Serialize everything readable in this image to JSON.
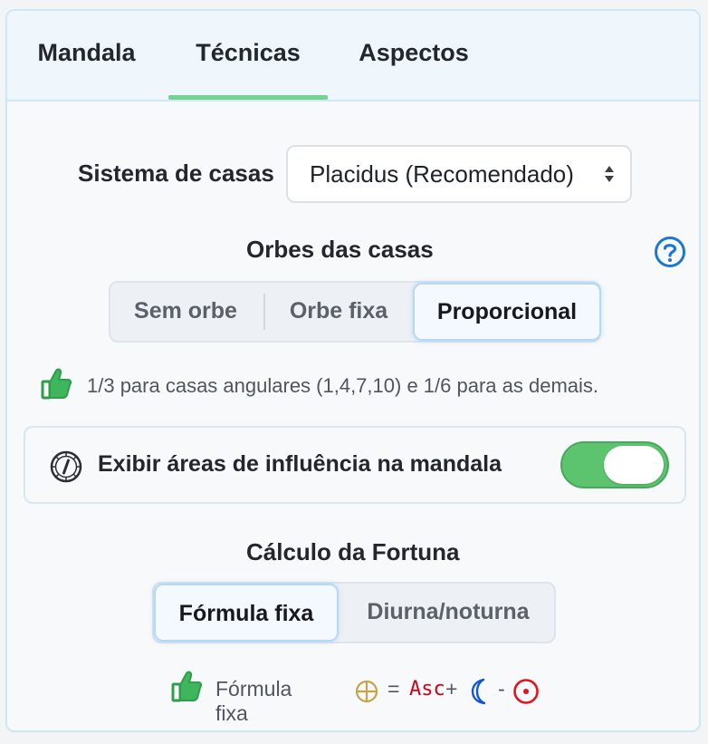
{
  "tabs": [
    {
      "label": "Mandala",
      "active": false
    },
    {
      "label": "Técnicas",
      "active": true
    },
    {
      "label": "Aspectos",
      "active": false
    }
  ],
  "house_system": {
    "label": "Sistema de casas",
    "selected": "Placidus (Recomendado)"
  },
  "house_orbs": {
    "title": "Orbes das casas",
    "options": [
      "Sem orbe",
      "Orbe fixa",
      "Proporcional"
    ],
    "selected": "Proporcional",
    "note": "1/3 para casas angulares (1,4,7,10) e 1/6 para as demais."
  },
  "influence_toggle": {
    "label": "Exibir áreas de influência na mandala",
    "on": true
  },
  "fortune": {
    "title": "Cálculo da Fortuna",
    "options": [
      "Fórmula fixa",
      "Diurna/noturna"
    ],
    "selected": "Fórmula fixa",
    "note_label": "Fórmula fixa",
    "formula": {
      "equals": "=",
      "asc": "Asc",
      "plus": "+",
      "minus": "-"
    }
  },
  "colors": {
    "accent_green": "#6fd391",
    "toggle_green": "#5cc46f",
    "thumb_green": "#2e9e49",
    "help_blue": "#1e76d3",
    "asc_red": "#d0021b",
    "moon_blue": "#1456d8",
    "sun_red": "#e3141e",
    "fortune_gold": "#c9a24a"
  },
  "icons": [
    "help-icon",
    "thumbs-up-icon",
    "clock-icon",
    "fortune-symbol-icon",
    "moon-icon",
    "sun-icon",
    "select-arrows-icon"
  ]
}
